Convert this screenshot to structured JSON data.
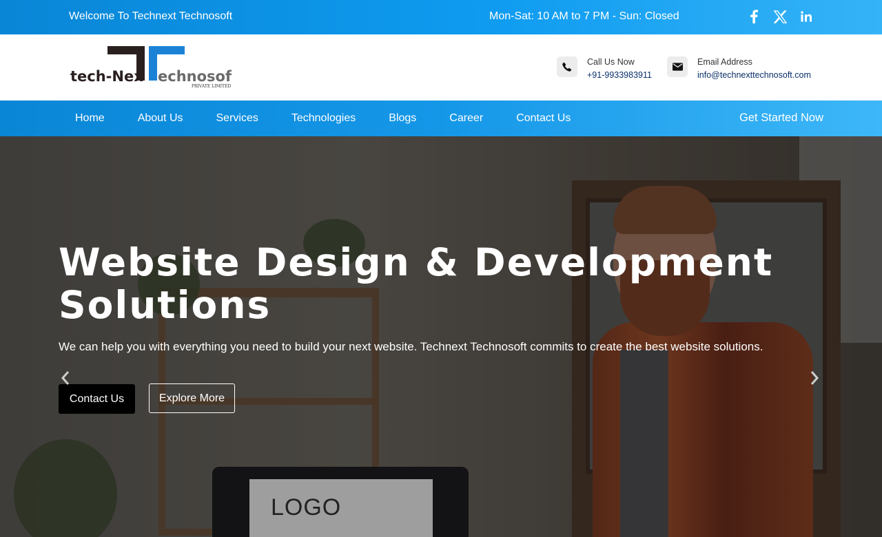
{
  "topbar": {
    "welcome": "Welcome To Technext Technosoft",
    "hours": "Mon-Sat: 10 AM to 7 PM - Sun: Closed",
    "social": [
      "facebook-icon",
      "x-icon",
      "linkedin-icon"
    ]
  },
  "header": {
    "logo": {
      "left_text": "tech-Nex",
      "right_text": "echnosoft",
      "tagline": "PRIVATE LIMITED"
    },
    "call": {
      "label": "Call Us Now",
      "value": "+91-9933983911",
      "icon": "phone-icon"
    },
    "email": {
      "label": "Email Address",
      "value": "info@technexttechnosoft.com",
      "icon": "envelope-icon"
    }
  },
  "nav": {
    "items": [
      "Home",
      "About Us",
      "Services",
      "Technologies",
      "Blogs",
      "Career",
      "Contact Us"
    ],
    "cta": "Get Started Now"
  },
  "hero": {
    "title": "Website Design & Development Solutions",
    "subtitle": "We can help you with everything you need to build your next website. Technext Technosoft commits to create the best website solutions.",
    "btn_contact": "Contact Us",
    "btn_explore": "Explore More",
    "screen_text": "LOGO"
  },
  "colors": {
    "brand_blue": "#0e9bf0",
    "nav_gradient_end": "#3db7f8",
    "link_navy": "#0a2f6b"
  }
}
